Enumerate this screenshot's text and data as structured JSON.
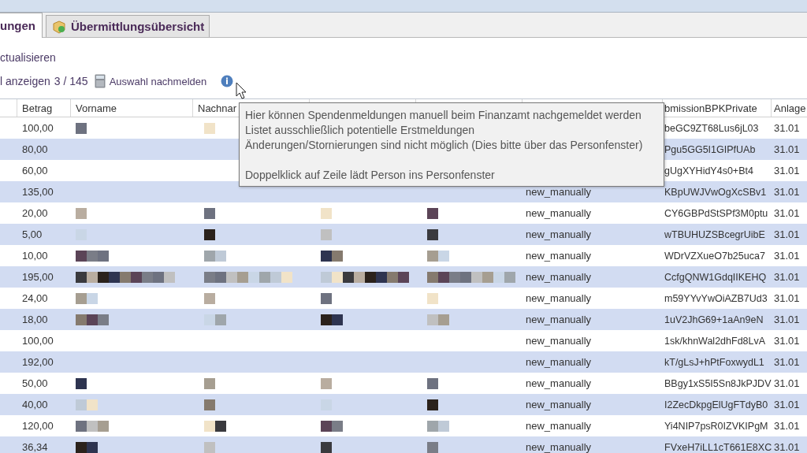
{
  "tabs": [
    {
      "label": "ungen",
      "selected": true,
      "icon": false
    },
    {
      "label": "Übermittlungsübersicht",
      "selected": false,
      "icon": true
    }
  ],
  "toolbar": {
    "refresh": "ctualisieren",
    "show_all": "l anzeigen",
    "count": "3 / 145",
    "report_button": "Auswahl nachmelden"
  },
  "tooltip": {
    "paragraphs": [
      [
        "Hier können Spendenmeldungen manuell beim Finanzamt nachgemeldet werden",
        "Listet ausschließlich potentielle Erstmeldungen",
        "Änderungen/Stornierungen sind nicht möglich (Dies bitte über das Personfenster)"
      ],
      [
        "Doppelklick auf Zeile lädt Person ins Personfenster"
      ]
    ]
  },
  "table": {
    "header": {
      "betrag": "Betrag",
      "vorname": "Vorname",
      "nachname": "Nachnar",
      "bpk": "bmissionBPKPrivate",
      "anlage": "Anlage"
    },
    "rows": [
      {
        "betrag": "100,00",
        "bpk": "beGC9ZT68Lus6jL03",
        "anlage": "31.01"
      },
      {
        "betrag": "80,00",
        "bpk": "Pgu5GG5I1GIPfUAb",
        "anlage": "31.01"
      },
      {
        "betrag": "60,00",
        "bpk": "gUgXYHidY4s0+Bt4",
        "anlage": "31.01"
      },
      {
        "betrag": "135,00",
        "status": "new_manually",
        "bpk": "KBpUWJVwOgXcSBv1",
        "anlage": "31.01"
      },
      {
        "betrag": "20,00",
        "status": "new_manually",
        "bpk": "CY6GBPdStSPf3M0ptu",
        "anlage": "31.01"
      },
      {
        "betrag": "5,00",
        "status": "new_manually",
        "bpk": "wTBUHUZSBcegrUibE",
        "anlage": "31.01"
      },
      {
        "betrag": "10,00",
        "status": "new_manually",
        "bpk": "WDrVZXueO7b25uca7",
        "anlage": "31.01"
      },
      {
        "betrag": "195,00",
        "status": "new_manually",
        "bpk": "CcfgQNW1GdqIIKEHQ",
        "anlage": "31.01"
      },
      {
        "betrag": "24,00",
        "status": "new_manually",
        "bpk": "m59YYvYwOiAZB7Ud3",
        "anlage": "31.01"
      },
      {
        "betrag": "18,00",
        "status": "new_manually",
        "bpk": "1uV2JhG69+1aAn9eN",
        "anlage": "31.01"
      },
      {
        "betrag": "100,00",
        "status": "new_manually",
        "bpk": "1sk/khnWal2dhFd8LvA",
        "anlage": "31.01"
      },
      {
        "betrag": "192,00",
        "status": "new_manually",
        "bpk": "kT/gLsJ+hPtFoxwydL1",
        "anlage": "31.01"
      },
      {
        "betrag": "50,00",
        "status": "new_manually",
        "bpk": "BBgy1xS5I5Sn8JkPJDV",
        "anlage": "31.01"
      },
      {
        "betrag": "40,00",
        "status": "new_manually",
        "bpk": "I2ZecDkpgElUgFTdyB0",
        "anlage": "31.01"
      },
      {
        "betrag": "120,00",
        "status": "new_manually",
        "bpk": "Yi4NIP7psR0IZVKIPgM",
        "anlage": "31.01"
      },
      {
        "betrag": "36,34",
        "status": "new_manually",
        "bpk": "FVxeH7iLL1cT661E8XC",
        "anlage": "31.01"
      }
    ]
  }
}
